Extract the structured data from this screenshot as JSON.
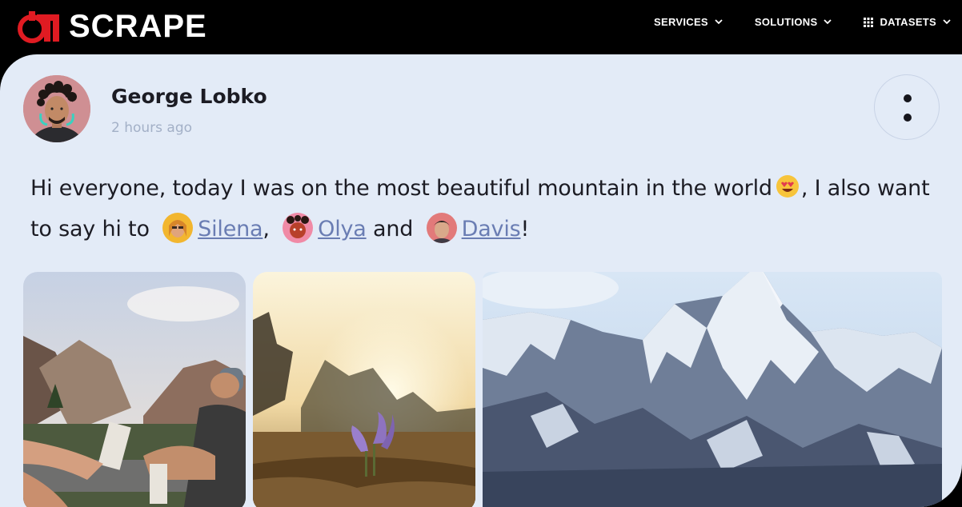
{
  "brand": {
    "logo_text": "SCRAPE",
    "logo_mark_text": "TT"
  },
  "nav": {
    "items": [
      {
        "label": "SERVICES",
        "icon": "chevron-down-icon"
      },
      {
        "label": "SOLUTIONS",
        "icon": "chevron-down-icon"
      },
      {
        "label": "DATASETS",
        "icon": "chevron-down-icon",
        "leading_icon": "grid-icon"
      }
    ]
  },
  "post": {
    "author": "George Lobko",
    "time": "2 hours ago",
    "text_part1": "Hi everyone, today I was on the most beautiful mountain in the world",
    "text_part2": ", I also want to say hi to",
    "mentions": [
      "Silena",
      "Olya",
      "Davis"
    ],
    "and_word": "and",
    "comma": ",",
    "end_punct": "!",
    "emoji": "heart-eyes-emoji",
    "photos": [
      "friends-in-canyon-photo",
      "crocus-at-sunset-photo",
      "snowy-mountain-photo"
    ]
  },
  "colors": {
    "panel_bg": "#e3ebf7",
    "mention": "#6a7db3",
    "timestamp": "#a3b0c7",
    "brand_red": "#e01b22"
  }
}
